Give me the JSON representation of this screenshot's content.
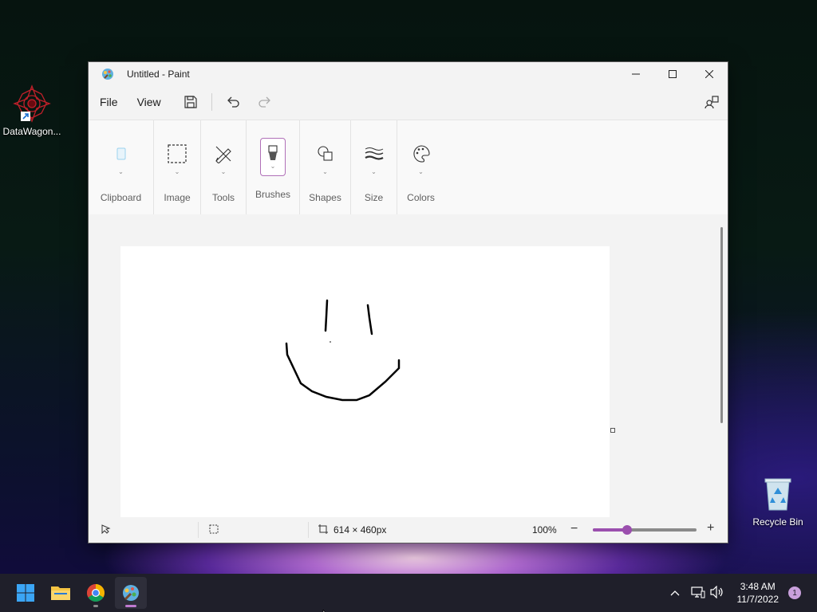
{
  "desktop": {
    "icons": [
      {
        "label": "DataWagon..."
      },
      {
        "label": "Recycle Bin"
      }
    ]
  },
  "window": {
    "title": "Untitled - Paint",
    "menu": {
      "file": "File",
      "view": "View"
    },
    "ribbon": {
      "groups": [
        {
          "label": "Clipboard",
          "icon": "clipboard-icon"
        },
        {
          "label": "Image",
          "icon": "selection-icon"
        },
        {
          "label": "Tools",
          "icon": "pencil-icon"
        },
        {
          "label": "Brushes",
          "icon": "brush-icon"
        },
        {
          "label": "Shapes",
          "icon": "shapes-icon"
        },
        {
          "label": "Size",
          "icon": "size-icon"
        },
        {
          "label": "Colors",
          "icon": "palette-icon"
        }
      ]
    },
    "status": {
      "canvas_size": "614 × 460px",
      "zoom": "100%",
      "zoom_level": 0.33
    }
  },
  "taskbar": {
    "time": "3:48 AM",
    "date": "11/7/2022",
    "notification_count": "1"
  },
  "colors": {
    "accent": "#9b4fae",
    "window_bg": "#f3f3f3"
  }
}
